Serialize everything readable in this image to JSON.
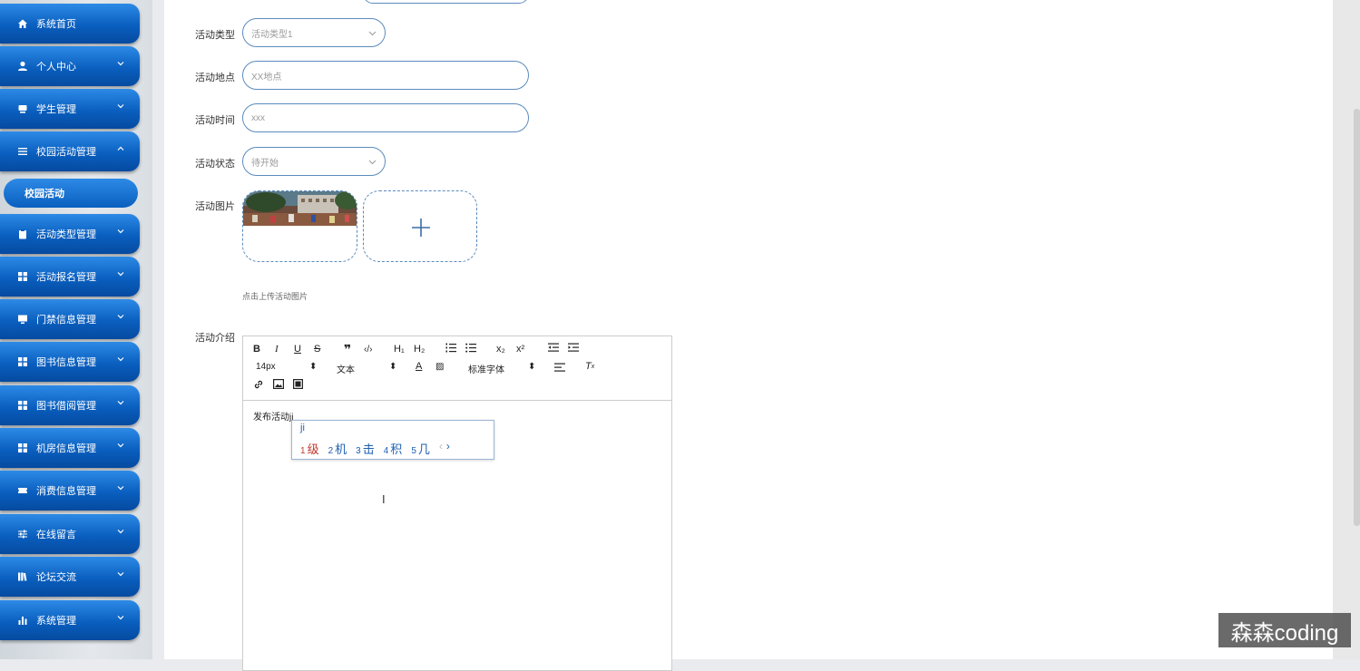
{
  "sidebar": {
    "items": [
      {
        "label": "系统首页",
        "icon": "home-icon",
        "expandable": false
      },
      {
        "label": "个人中心",
        "icon": "user-icon",
        "expandable": true
      },
      {
        "label": "学生管理",
        "icon": "student-icon",
        "expandable": true
      },
      {
        "label": "校园活动管理",
        "icon": "list-icon",
        "expandable": true,
        "expanded": true
      },
      {
        "label": "活动类型管理",
        "icon": "clipboard-icon",
        "expandable": true
      },
      {
        "label": "活动报名管理",
        "icon": "grid-icon",
        "expandable": true
      },
      {
        "label": "门禁信息管理",
        "icon": "monitor-icon",
        "expandable": true
      },
      {
        "label": "图书信息管理",
        "icon": "grid-icon",
        "expandable": true
      },
      {
        "label": "图书借阅管理",
        "icon": "grid-icon",
        "expandable": true
      },
      {
        "label": "机房信息管理",
        "icon": "grid-icon",
        "expandable": true
      },
      {
        "label": "消费信息管理",
        "icon": "ticket-icon",
        "expandable": true
      },
      {
        "label": "在线留言",
        "icon": "sliders-icon",
        "expandable": true
      },
      {
        "label": "论坛交流",
        "icon": "books-icon",
        "expandable": true
      },
      {
        "label": "系统管理",
        "icon": "bar-chart-icon",
        "expandable": true
      }
    ],
    "sub_item": "校园活动"
  },
  "form": {
    "activity_type": {
      "label": "活动类型",
      "value": "活动类型1"
    },
    "location": {
      "label": "活动地点",
      "placeholder": "XX地点"
    },
    "time": {
      "label": "活动时间",
      "placeholder": "xxx"
    },
    "status": {
      "label": "活动状态",
      "value": "待开始"
    },
    "image": {
      "label": "活动图片",
      "hint": "点击上传活动图片"
    },
    "intro": {
      "label": "活动介绍"
    }
  },
  "editor": {
    "font_size": "14px",
    "paragraph": "文本",
    "font_family": "标准字体",
    "content": "发布活动",
    "toolbar_icons": [
      "bold-icon",
      "italic-icon",
      "underline-icon",
      "strike-icon",
      "quote-icon",
      "code-icon",
      "h1-icon",
      "h2-icon",
      "ordered-list-icon",
      "bullet-list-icon",
      "subscript-icon",
      "superscript-icon",
      "outdent-icon",
      "indent-icon",
      "font-color-icon",
      "background-color-icon",
      "align-icon",
      "clear-format-icon",
      "link-icon",
      "image-icon",
      "video-icon"
    ]
  },
  "ime": {
    "input": "ji",
    "candidates": [
      {
        "num": "1",
        "text": "级"
      },
      {
        "num": "2",
        "text": "机"
      },
      {
        "num": "3",
        "text": "击"
      },
      {
        "num": "4",
        "text": "积"
      },
      {
        "num": "5",
        "text": "几"
      }
    ]
  },
  "watermark": "森森coding",
  "colors": {
    "accent": "#0a5fbf",
    "input_border": "#5b8bbd",
    "highlight": "#c0392b"
  }
}
